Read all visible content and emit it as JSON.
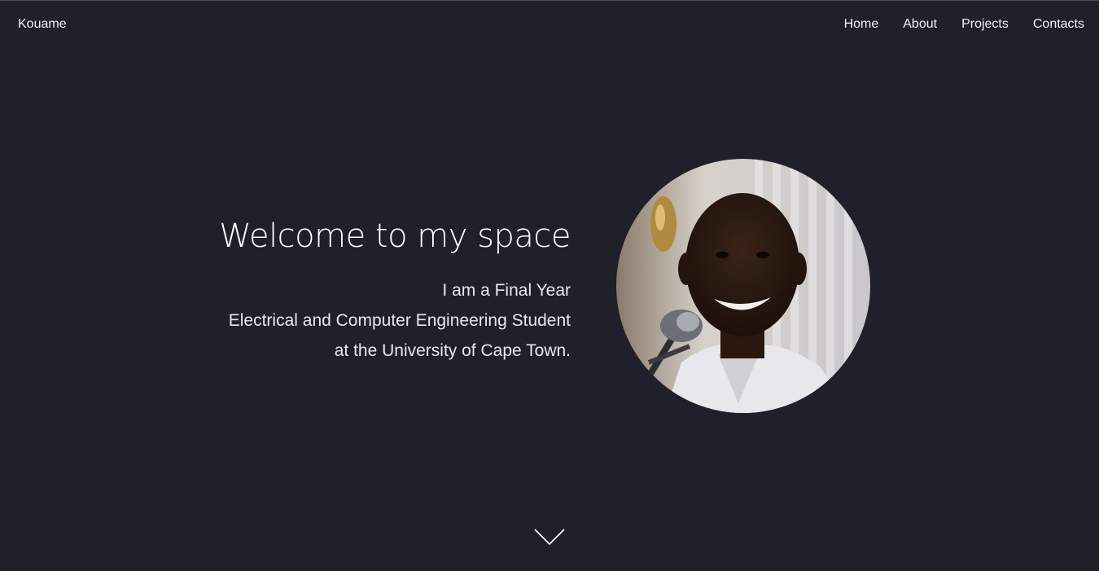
{
  "header": {
    "brand": "Kouame",
    "nav": [
      {
        "label": "Home"
      },
      {
        "label": "About"
      },
      {
        "label": "Projects"
      },
      {
        "label": "Contacts"
      }
    ]
  },
  "hero": {
    "title": "Welcome to my space",
    "lines": [
      "I am a Final Year",
      "Electrical and Computer Engineering Student",
      "at the University of Cape Town."
    ]
  },
  "icons": {
    "scroll": "chevron-down-icon"
  },
  "colors": {
    "background": "#1f2029",
    "text": "#ffffff"
  }
}
